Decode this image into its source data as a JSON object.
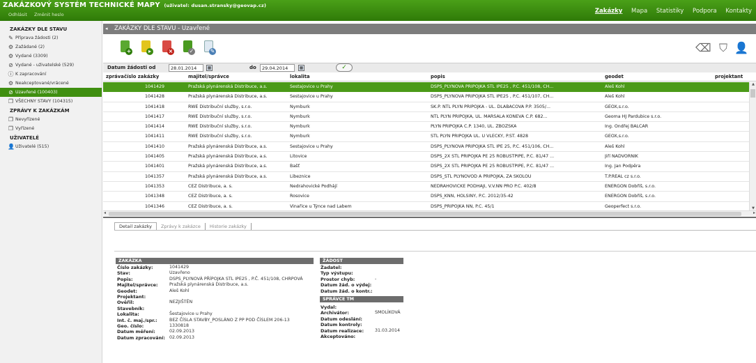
{
  "app": {
    "title": "ZAKÁZKOVÝ SYSTÉM TECHNICKÉ MAPY",
    "user": "(uživatel: dusan.stransky@geovap.cz)",
    "logout": "Odhlásit",
    "change_password": "Změnit heslo"
  },
  "nav": [
    {
      "label": "Zakázky",
      "active": true
    },
    {
      "label": "Mapa",
      "active": false
    },
    {
      "label": "Statistiky",
      "active": false
    },
    {
      "label": "Podpora",
      "active": false
    },
    {
      "label": "Kontakty",
      "active": false
    }
  ],
  "sidebar": {
    "section1": "ZAKÁZKY DLE STAVU",
    "items1": [
      {
        "label": "Příprava žádosti (2)",
        "icon": "edit-icon",
        "glyph": "✎"
      },
      {
        "label": "Zažádané (2)",
        "icon": "gear-icon",
        "glyph": "⚙"
      },
      {
        "label": "Vydané (3309)",
        "icon": "gear-icon",
        "glyph": "⚙"
      },
      {
        "label": "Vydané - uživatelské (529)",
        "icon": "prohibited-icon",
        "glyph": "⊘"
      },
      {
        "label": "K zapracování",
        "icon": "info-icon",
        "glyph": "ⓘ"
      },
      {
        "label": "Neakceptované/vrácené",
        "icon": "gear-icon",
        "glyph": "⚙"
      },
      {
        "label": "Uzavřené (100403)",
        "icon": "prohibited-icon",
        "glyph": "⊘",
        "active": true
      },
      {
        "label": "VŠECHNY STAVY (104315)",
        "icon": "stack-icon",
        "glyph": "❐"
      }
    ],
    "section2": "ZPRÁVY K ZAKÁZKÁM",
    "items2": [
      {
        "label": "Nevyřízené",
        "icon": "copy-icon",
        "glyph": "❐"
      },
      {
        "label": "Vyřízené",
        "icon": "copy-icon",
        "glyph": "❐"
      }
    ],
    "section3": "UŽIVATELÉ",
    "items3": [
      {
        "label": "Uživatelé (515)",
        "icon": "user-icon",
        "glyph": "👤"
      }
    ]
  },
  "page": {
    "title": "ZAKÁZKY DLE STAVU - Uzavřené"
  },
  "filter": {
    "from_label": "Datum žádosti od",
    "from_value": "28.01.2014",
    "to_label": "do",
    "to_value": "29.04.2014"
  },
  "table": {
    "headers": [
      "zpráva",
      "číslo zakázky",
      "majitel/správce",
      "lokalita",
      "popis",
      "geodet",
      "projektant"
    ],
    "rows": [
      [
        "",
        "1041429",
        "Pražská plynárenská Distribuce, a.s.",
        "Šestajovice u Prahy",
        "DSPS_PLYNOVÁ PŘÍPOJKA STL IPE25 , P.Č. 451/108, CH...",
        "Aleš Kohl",
        ""
      ],
      [
        "",
        "1041428",
        "Pražská plynárenská Distribuce, a.s.",
        "Šestajovice u Prahy",
        "DSPS_PLYNOVÁ PŘÍPOJKA STL IPE25 , P.Č. 451/107, CH...",
        "Aleš Kohl",
        ""
      ],
      [
        "",
        "1041418",
        "RWE Distribuční služby, s.r.o.",
        "Nymburk",
        "SK.P. NTL PLYN PŘÍPOJKA - UL. DLABAČOVA P.P. 3505/...",
        "GEOX,s.r.o.",
        ""
      ],
      [
        "",
        "1041417",
        "RWE Distribuční služby, s.r.o.",
        "Nymburk",
        "NTL PLYN PŘÍPOJKA, UL. MARŠÁLA KONĚVA Č.P. 682...",
        "Geoma HJ Pardubice s.r.o.",
        ""
      ],
      [
        "",
        "1041414",
        "RWE Distribuční služby, s.r.o.",
        "Nymburk",
        "PLYN PŘÍPOJKA Č.P. 1340, UL. ZBOŽSKÁ",
        "Ing. Ondřej BALCAR",
        ""
      ],
      [
        "",
        "1041411",
        "RWE Distribuční služby, s.r.o.",
        "Nymburk",
        "STL PLYN PŘÍPOJKA UL. U VLEČKY, P.ST. 4828",
        "GEOX,s.r.o.",
        ""
      ],
      [
        "",
        "1041410",
        "Pražská plynárenská Distribuce, a.s.",
        "Šestajovice u Prahy",
        "DSPS_PLYNOVÁ PŘÍPOJKA STL IPE 25, P.Č. 451/106, CH...",
        "Aleš Kohl",
        ""
      ],
      [
        "",
        "1041405",
        "Pražská plynárenská Distribuce, a.s.",
        "Litovice",
        "DSPS_2X STL PŘÍPOJKA PE 25 ROBUSTPIPE, P.Č. 81/47 ...",
        "Jiří NÁDVORNÍK",
        ""
      ],
      [
        "",
        "1041401",
        "Pražská plynárenská Distribuce, a.s.",
        "Bašť",
        "DSPS_2X STL PŘÍPOJKA PE 25 ROBUSTPIPE, P.Č. 81/47 ...",
        "Ing. Jan Podpěra",
        ""
      ],
      [
        "",
        "1041357",
        "Pražská plynárenská Distribuce, a.s.",
        "Libeznice",
        "DSPS_STL PLYNOVOD A PŘÍPOJKA, ZA ŠKOLOU",
        "T.P.REAL cz s.r.o.",
        ""
      ],
      [
        "",
        "1041353",
        "ČEZ Distribuce, a. s.",
        "Nedrahovické Podhájí",
        "NEDRAHOVICKÉ PODHÁJÍ, V.V.NN PRO P.Č. 402/8",
        "ENERGON Dobříš, s.r.o.",
        ""
      ],
      [
        "",
        "1041348",
        "ČEZ Distribuce, a. s.",
        "Rosovice",
        "DSPS_KNN, HOLŠINY, P.Č. 2012/35-42",
        "ENERGON Dobříš, s.r.o.",
        ""
      ],
      [
        "",
        "1041346",
        "ČEZ Distribuce, a. s.",
        "Vinařice u Týnce nad Labem",
        "DSPS_PŘÍPOJKA NN, P.Č. 45/1",
        "Geoperfect s.r.o.",
        ""
      ]
    ]
  },
  "tabs": [
    "Detail zakázky",
    "Zprávy k zakázce",
    "Historie zakázky"
  ],
  "detail": {
    "zakazka_head": "ZAKÁZKA",
    "zakazka": [
      {
        "k": "Číslo zakázky:",
        "v": "1041429"
      },
      {
        "k": "Stav:",
        "v": "Uzavřeno"
      },
      {
        "k": "Popis:",
        "v": "DSPS_PLYNOVÁ PŘÍPOJKA STL IPE25 , P.Č. 451/108, CHRPOVÁ"
      },
      {
        "k": "Majitel/správce:",
        "v": "Pražská plynárenská Distribuce, a.s."
      },
      {
        "k": "Geodet:",
        "v": "Aleš Kohl"
      },
      {
        "k": "Projektant:",
        "v": ""
      },
      {
        "k": "Ověřil:",
        "v": "NEZJIŠTĚN"
      },
      {
        "k": "Stavebník:",
        "v": ""
      },
      {
        "k": "Lokalita:",
        "v": "Šestajovice u Prahy"
      },
      {
        "k": "Int. č. maj./spr.:",
        "v": "BEZ ČÍSLA STAVBY_POSLÁNO Z PP POD ČÍSLEM 206-13"
      },
      {
        "k": "Geo. číslo:",
        "v": "1330818"
      },
      {
        "k": "Datum měření:",
        "v": "02.09.2013"
      },
      {
        "k": "Datum zpracování:",
        "v": "02.09.2013"
      }
    ],
    "zadost_head": "ŽÁDOST",
    "zadost": [
      {
        "k": "Žadatel:",
        "v": ""
      },
      {
        "k": "Typ výstupu:",
        "v": ""
      },
      {
        "k": "Prostor chyb:",
        "v": "-"
      },
      {
        "k": "Datum žád. o výdej:",
        "v": ""
      },
      {
        "k": "Datum žád. o kontr.:",
        "v": ""
      }
    ],
    "spravce_head": "SPRÁVCE TM",
    "spravce": [
      {
        "k": "Vydal:",
        "v": ""
      },
      {
        "k": "Archivátor:",
        "v": "SMOLÍKOVÁ"
      },
      {
        "k": "Datum odeslání:",
        "v": ""
      },
      {
        "k": "Datum kontroly:",
        "v": ""
      },
      {
        "k": "Datum realizace:",
        "v": "31.03.2014"
      },
      {
        "k": "Akceptováno:",
        "v": ""
      }
    ]
  },
  "colors": {
    "brand_green": "#3c8a10",
    "selected_row": "#4b9a18",
    "header_gray": "#7d7d7d"
  }
}
